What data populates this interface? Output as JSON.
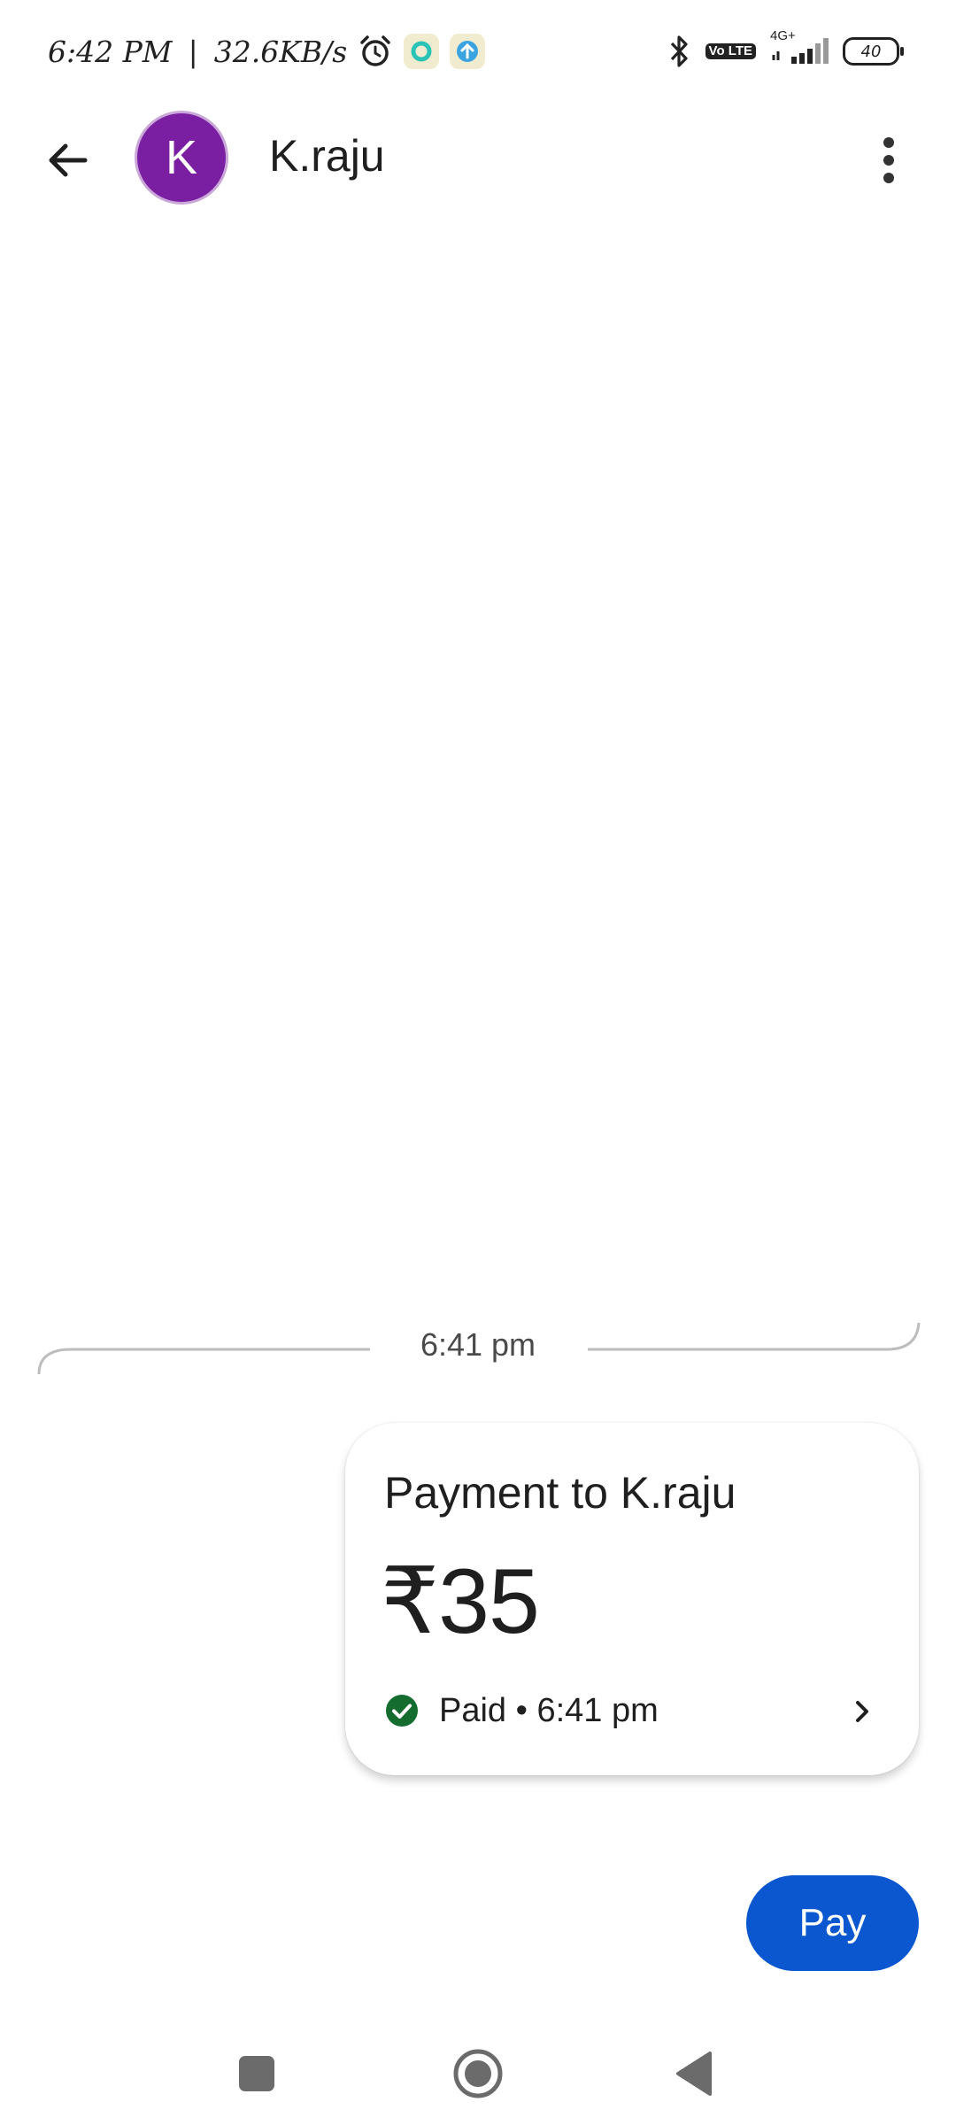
{
  "status_bar": {
    "time": "6:42 PM",
    "separator": "|",
    "network_speed": "32.6KB/s",
    "network_type": "4G+",
    "volte": "Vo LTE",
    "battery": "40",
    "icons": [
      "alarm-icon",
      "app-a-icon",
      "upload-app-icon",
      "bluetooth-icon",
      "volte-icon",
      "signal-icon",
      "battery-icon"
    ]
  },
  "header": {
    "avatar_letter": "K",
    "avatar_color": "#7b1fa2",
    "contact_name": "K.raju"
  },
  "conversation": {
    "time_separator": "6:41 pm",
    "payment_card": {
      "title": "Payment to K.raju",
      "amount": "₹35",
      "status": "Paid • 6:41 pm",
      "status_color": "#146c2e"
    }
  },
  "actions": {
    "pay_label": "Pay",
    "pay_color": "#0b57d0"
  },
  "nav_bar": {
    "icons": [
      "recents-icon",
      "home-icon",
      "back-triangle-icon"
    ]
  }
}
